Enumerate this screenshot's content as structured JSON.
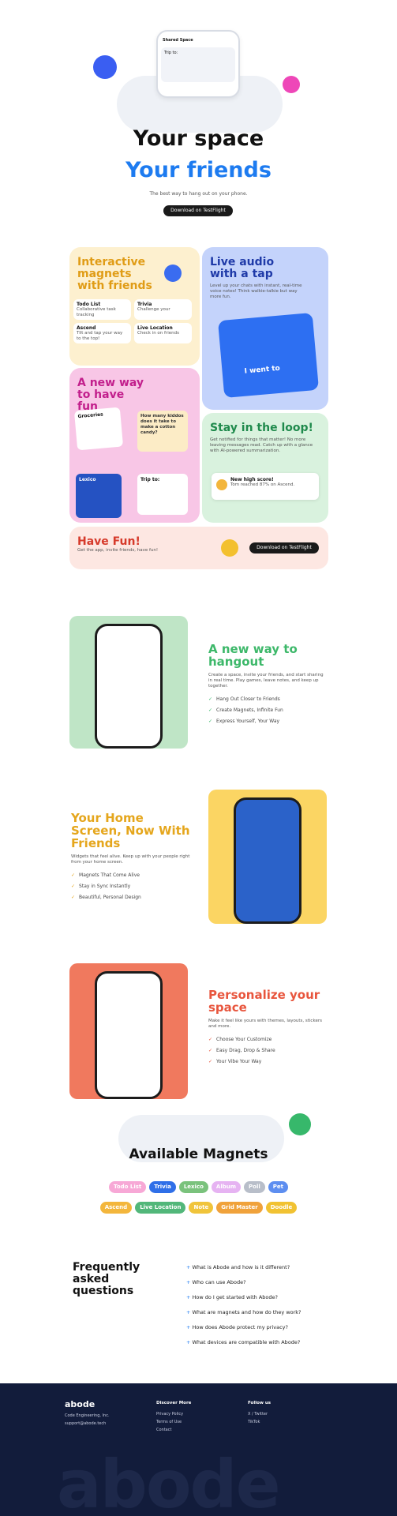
{
  "hero": {
    "title_line1": "Your space",
    "title_line2": "Your friends",
    "subtitle": "The best way to hang out on your phone.",
    "cta": "Download on TestFlight",
    "phone_name": "Shared Space",
    "phone_card": "Trip to:"
  },
  "features": {
    "magnets": {
      "title": "Interactive magnets with friends",
      "items": [
        {
          "name": "Todo List",
          "desc": "Collaborative task tracking"
        },
        {
          "name": "Trivia",
          "desc": "Challenge your"
        },
        {
          "name": "Ascend",
          "desc": "Tilt and tap your way to the top!"
        },
        {
          "name": "Live Location",
          "desc": "Check in on friends"
        }
      ]
    },
    "audio": {
      "title": "Live audio with a tap",
      "desc": "Level up your chats with instant, real-time voice notes! Think walkie-talkie but way more fun.",
      "bubble": "I went to"
    },
    "fun": {
      "title": "A new way to have fun",
      "groceries": "Groceries",
      "trivia_q": "How many kiddos does it take to make a cotton candy?",
      "lexico": "Lexico",
      "trip": "Trip to:"
    },
    "loop": {
      "title": "Stay in the loop!",
      "desc": "Get notified for things that matter! No more leaving messages read. Catch up with a glance with AI-powered summarization.",
      "notif_title": "New high score!",
      "notif_body": "Tom reached 87% on Ascend."
    },
    "havefun": {
      "title": "Have Fun!",
      "desc": "Get the app, invite friends, have fun!",
      "cta": "Download on TestFlight"
    }
  },
  "sections": [
    {
      "title": "A new way to hangout",
      "desc": "Create a space, invite your friends, and start sharing in real time. Play games, leave notes, and keep up together.",
      "points": [
        "Hang Out Closer to Friends",
        "Create Magnets, Infinite Fun",
        "Express Yourself, Your Way"
      ],
      "color": "#3db86a"
    },
    {
      "title": "Your Home Screen, Now With Friends",
      "desc": "Widgets that feel alive. Keep up with your people right from your home screen.",
      "points": [
        "Magnets That Come Alive",
        "Stay in Sync Instantly",
        "Beautiful, Personal Design"
      ],
      "color": "#e5a61c"
    },
    {
      "title": "Personalize your space",
      "desc": "Make it feel like yours with themes, layouts, stickers and more.",
      "points": [
        "Choose Your Customize",
        "Easy Drag, Drop & Share",
        "Your Vibe Your Way"
      ],
      "color": "#e8553d"
    }
  ],
  "magnets": {
    "title": "Available Magnets",
    "row1": [
      {
        "label": "Todo List",
        "color": "#f7a8d6"
      },
      {
        "label": "Trivia",
        "color": "#2f6fe8"
      },
      {
        "label": "Lexico",
        "color": "#7ac27c"
      },
      {
        "label": "Album",
        "color": "#e6b3f2"
      },
      {
        "label": "Poll",
        "color": "#b8bec9"
      },
      {
        "label": "Pet",
        "color": "#5d8ef0"
      }
    ],
    "row2": [
      {
        "label": "Ascend",
        "color": "#f3b63c"
      },
      {
        "label": "Live Location",
        "color": "#52b77a"
      },
      {
        "label": "Note",
        "color": "#f0c43a"
      },
      {
        "label": "Grid Master",
        "color": "#f0a23b"
      },
      {
        "label": "Doodle",
        "color": "#f1c232"
      }
    ]
  },
  "faq": {
    "title": "Frequently asked questions",
    "items": [
      "What is Abode and how is it different?",
      "Who can use Abode?",
      "How do I get started with Abode?",
      "What are magnets and how do they work?",
      "How does Abode protect my privacy?",
      "What devices are compatible with Abode?"
    ]
  },
  "footer": {
    "logo": "abode",
    "company": "Code Engineering, Inc.",
    "email": "support@abode.tech",
    "col1_title": "Discover More",
    "col1": [
      "Privacy Policy",
      "Terms of Use",
      "Contact"
    ],
    "col2_title": "Follow us",
    "col2": [
      "X / Twitter",
      "TikTok"
    ],
    "bg_word": "abode"
  },
  "colors": {
    "blue": "#1d7bf0",
    "footer": "#121c3b"
  }
}
